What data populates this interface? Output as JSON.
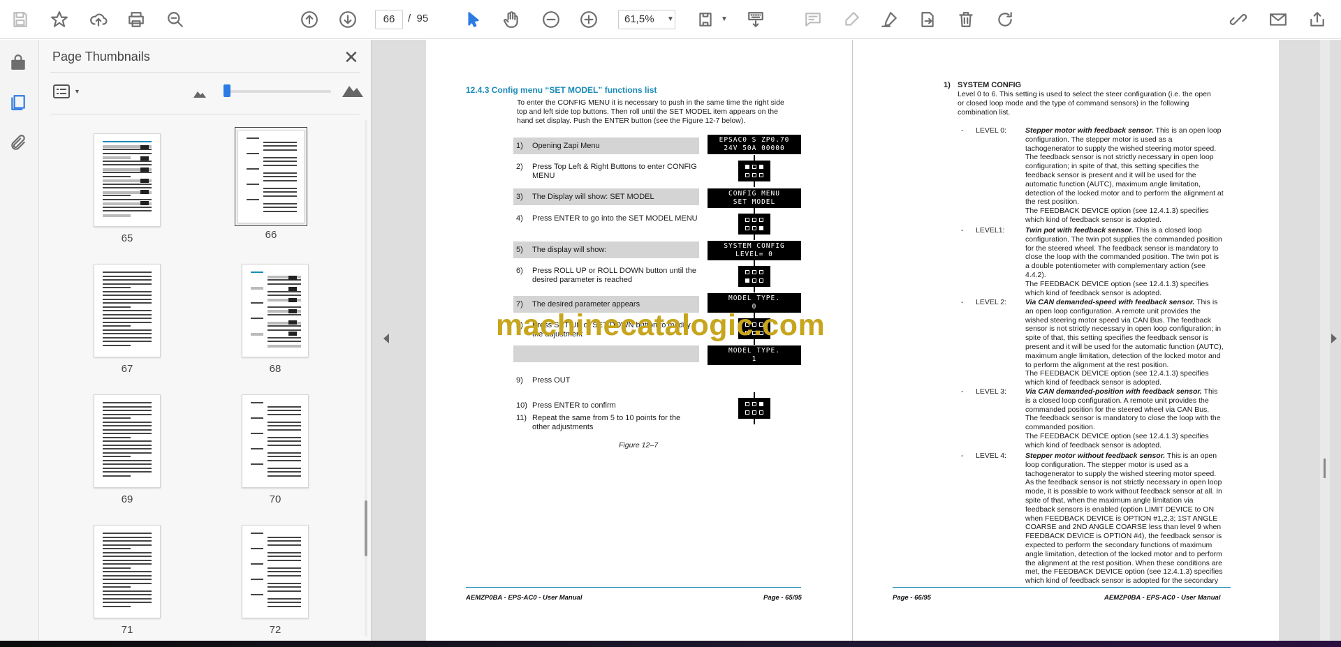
{
  "toolbar": {
    "page_current": "66",
    "page_separator": "/",
    "page_total": "95",
    "zoom": "61,5%"
  },
  "panel": {
    "title": "Page Thumbnails",
    "thumbnails": [
      {
        "label": "65"
      },
      {
        "label": "66"
      },
      {
        "label": "67"
      },
      {
        "label": "68"
      },
      {
        "label": "69"
      },
      {
        "label": "70"
      },
      {
        "label": "71"
      },
      {
        "label": "72"
      }
    ]
  },
  "left_page": {
    "heading": "12.4.3 Config menu “SET MODEL” functions list",
    "intro": [
      "To enter the CONFIG MENU it is necessary to push in the same time the right side",
      "top and left side top buttons. Then roll until the SET MODEL item appears on the",
      "hand set display. Push the ENTER button (see the Figure 12-7 below)."
    ],
    "steps": [
      {
        "n": "1)",
        "text": "Opening Zapi Menu"
      },
      {
        "n": "2)",
        "text": "Press Top Left & Right Buttons to enter CONFIG MENU"
      },
      {
        "n": "3)",
        "text": "The Display will show: SET MODEL"
      },
      {
        "n": "4)",
        "text": "Press ENTER to go into the SET MODEL MENU"
      },
      {
        "n": "5)",
        "text": "The display will show:"
      },
      {
        "n": "6)",
        "text": "Press ROLL UP or ROLL DOWN button until the desired parameter is reached"
      },
      {
        "n": "7)",
        "text": "The desired parameter appears"
      },
      {
        "n": "8)",
        "text": "Press SET UP or SET DOWN button to modify the adjustment"
      },
      {
        "n": "",
        "text": ""
      },
      {
        "n": "9)",
        "text": "Press OUT"
      },
      {
        "n": "10)",
        "text": "Press ENTER to confirm"
      },
      {
        "n": "11)",
        "text": "Repeat the same from 5 to 10 points for the other adjustments"
      }
    ],
    "lcd": [
      {
        "l1": "EPSAC0  S  ZP0.70",
        "l2": "24V  50A  00000"
      },
      {
        "l1": "CONFIG MENU",
        "l2": "SET MODEL"
      },
      {
        "l1": "SYSTEM CONFIG",
        "l2": "LEVEL= 0"
      },
      {
        "l1": "MODEL TYPE.",
        "l2": "0"
      },
      {
        "l1": "MODEL TYPE.",
        "l2": "1"
      }
    ],
    "figure": "Figure 12–7",
    "footer_left": "AEMZP0BA - EPS-AC0 - User Manual",
    "footer_right": "Page - 65/95",
    "watermark": "machinecatalogic.com"
  },
  "right_page": {
    "section_no": "1)",
    "section_title": "SYSTEM CONFIG",
    "section_intro": [
      "Level 0 to 6. This setting is used to select the steer configuration (i.e. the open",
      "or closed loop mode and the type of command sensors) in the following",
      "combination list."
    ],
    "levels": [
      {
        "label": "-      LEVEL 0:",
        "title": "Stepper motor with feedback sensor.",
        "lines": [
          " This is an open loop",
          "configuration. The stepper motor is used as a",
          "tachogenerator to supply the wished steering motor speed.",
          "The feedback sensor is not strictly necessary in open loop",
          "configuration; in spite of that, this setting specifies the",
          "feedback sensor is present and it will be used for the",
          "automatic function (AUTC), maximum angle limitation,",
          "detection of the locked motor and to perform the alignment at",
          "the rest position.",
          "The FEEDBACK DEVICE option (see 12.4.1.3) specifies",
          "which kind of feedback sensor is adopted."
        ]
      },
      {
        "label": "-      LEVEL1:",
        "title": "Twin pot with feedback sensor.",
        "lines": [
          " This is a closed loop",
          "configuration. The twin pot supplies the commanded position",
          "for the steered wheel. The feedback sensor is mandatory to",
          "close the loop with the commanded position. The twin pot is",
          "a double potentiometer with complementary action (see",
          "4.4.2).",
          "The FEEDBACK DEVICE option (see 12.4.1.3) specifies",
          "which kind of feedback sensor is adopted."
        ]
      },
      {
        "label": "-      LEVEL 2:",
        "title": "Via CAN demanded-speed with feedback sensor.",
        "lines": [
          " This is",
          "an open loop configuration. A remote unit provides the",
          "wished steering motor speed via CAN Bus. The feedback",
          "sensor is not strictly necessary in open loop configuration; in",
          "spite of that, this setting specifies the feedback sensor is",
          "present and it will be used for the automatic function (AUTC),",
          "maximum angle limitation, detection of the locked motor and",
          "to perform the alignment at the rest position.",
          "The FEEDBACK DEVICE option (see 12.4.1.3) specifies",
          "which kind of feedback sensor is adopted."
        ]
      },
      {
        "label": "-      LEVEL 3:",
        "title": "Via CAN demanded-position with feedback sensor.",
        "lines": [
          " This",
          "is a closed loop configuration. A remote unit provides the",
          "commanded position for the steered wheel via CAN Bus.",
          "The feedback sensor is mandatory to close the loop with the",
          "commanded position.",
          "The FEEDBACK DEVICE option (see 12.4.1.3) specifies",
          "which kind of feedback sensor is adopted."
        ]
      },
      {
        "label": "-      LEVEL 4:",
        "title": "Stepper motor without feedback sensor.",
        "lines": [
          " This is an open",
          "loop configuration. The stepper motor is used as a",
          "tachogenerator to supply the wished steering motor speed.",
          "As the feedback sensor is not strictly necessary in open loop",
          "mode, it is possible to work without feedback sensor at all. In",
          "spite of that, when the maximum angle limitation via",
          "feedback sensors is enabled (option LIMIT DEVICE to ON",
          "when FEEDBACK DEVICE is OPTION #1,2,3; 1ST ANGLE",
          "COARSE and 2ND ANGLE COARSE less than level 9 when",
          "FEEDBACK DEVICE is OPTION #4), the feedback sensor is",
          "expected to perform the secondary functions of maximum",
          "angle limitation, detection of the locked motor and to perform",
          "the alignment at the rest position. When these conditions are",
          "met, the FEEDBACK DEVICE option (see 12.4.1.3) specifies",
          "which kind of feedback sensor is adopted for the secondary"
        ]
      }
    ],
    "footer_left": "Page - 66/95",
    "footer_right": "AEMZP0BA - EPS-AC0 - User Manual"
  }
}
